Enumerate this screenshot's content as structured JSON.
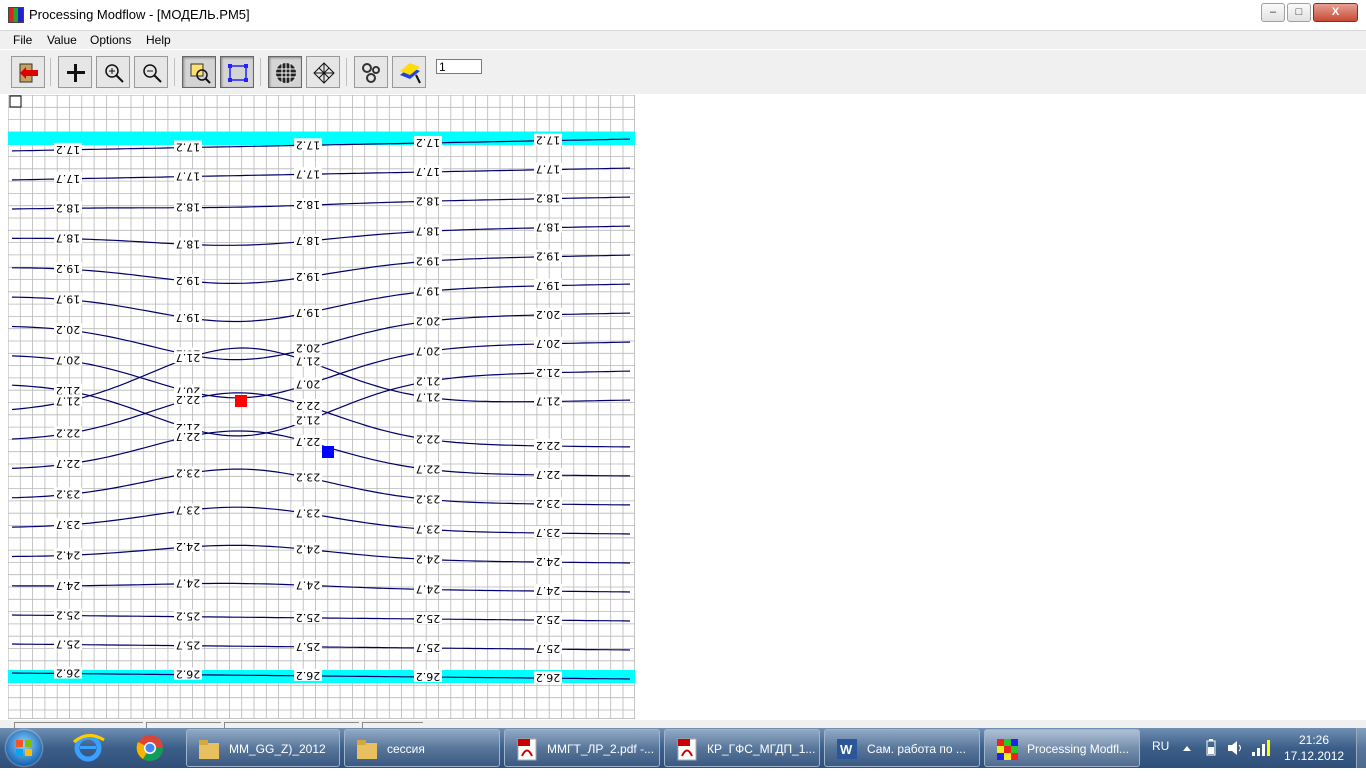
{
  "window": {
    "title": "Processing Modflow - [МОДЕЛЬ.PM5]",
    "minimize": "–",
    "restore": "□",
    "close": "X"
  },
  "menu": [
    "File",
    "Value",
    "Options",
    "Help"
  ],
  "toolbar": {
    "layer_value": "1",
    "buttons": [
      "exit-icon",
      "add-icon",
      "zoom-in-icon",
      "zoom-out-icon",
      "search-cell-icon",
      "select-area-icon",
      "grid-icon",
      "mesh-icon",
      "settings-icon",
      "color-map-icon"
    ]
  },
  "map": {
    "wells": [
      {
        "color": "#ff0000"
      },
      {
        "color": "#0000ff"
      }
    ],
    "boundary_color": "#00ffff",
    "contour_color": "#00006a",
    "contour_labels": [
      "17.2",
      "17.7",
      "18.2",
      "18.7",
      "19.2",
      "19.7",
      "20.2",
      "20.7",
      "21.2",
      "21.7",
      "22.2",
      "22.7",
      "23.2",
      "23.7",
      "24.2",
      "24.7",
      "25.2",
      "25.7",
      "26.2"
    ]
  },
  "taskbar": {
    "items": [
      {
        "label": "MM_GG_Z)_2012",
        "icon": "folder-icon"
      },
      {
        "label": "сессия",
        "icon": "folder-icon"
      },
      {
        "label": "ММГТ_ЛР_2.pdf -...",
        "icon": "pdf-icon"
      },
      {
        "label": "КР_ГФС_МГДП_1...",
        "icon": "pdf-icon"
      },
      {
        "label": "Сам. работа по ...",
        "icon": "word-icon"
      },
      {
        "label": "Processing Modfl...",
        "icon": "rubik-icon"
      }
    ],
    "language": "RU",
    "time": "21:26",
    "date": "17.12.2012"
  }
}
